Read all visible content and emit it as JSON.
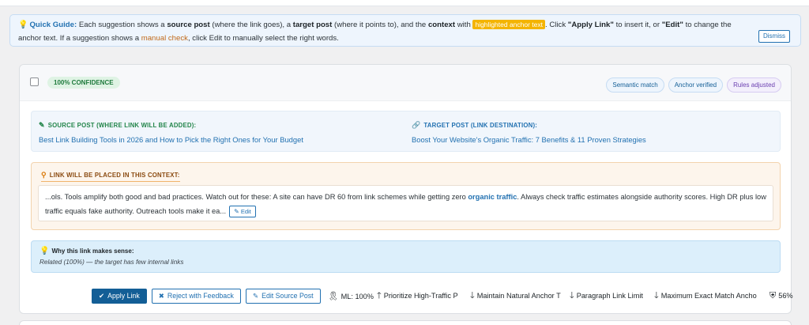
{
  "guide": {
    "lead": "Quick Guide:",
    "t1": " Each suggestion shows a ",
    "b1": "source post",
    "t2": " (where the link goes), a ",
    "b2": "target post",
    "t3": " (where it points to), and the ",
    "b3": "context",
    "t4": " with ",
    "chip": "highlighted anchor text",
    "t5": ". Click ",
    "b4": "\"Apply Link\"",
    "t6": " to insert it, or ",
    "b5": "\"Edit\"",
    "t7": " to change the anchor text. If a suggestion shows a ",
    "orange": "manual check",
    "t8": ", click Edit to manually select the right words.",
    "dismiss_label": "Dismiss"
  },
  "card": {
    "confidence": "100% CONFIDENCE",
    "chips": [
      "Semantic match",
      "Anchor verified",
      "Rules adjusted"
    ],
    "source": {
      "label": "SOURCE POST (WHERE LINK WILL BE ADDED):",
      "title": "Best Link Building Tools in 2026 and How to Pick the Right Ones for Your Budget"
    },
    "target": {
      "label": "TARGET POST (LINK DESTINATION):",
      "title": "Boost Your Website's Organic Traffic: 7 Benefits & 11 Proven Strategies"
    },
    "context": {
      "label": "LINK WILL BE PLACED IN THIS CONTEXT:",
      "before": "...ols. Tools amplify both good and bad practices. Watch out for these: A site can have DR 60 from link schemes while getting zero ",
      "anchor": "organic traffic",
      "after": ". Always check traffic estimates alongside authority scores. High DR plus low traffic equals fake authority. Outreach tools make it ea...",
      "edit_label": "Edit"
    },
    "why": {
      "title": "Why this link makes sense:",
      "text": "Related (100%) — the target has few internal links"
    },
    "actions": {
      "apply": "Apply Link",
      "reject": "Reject with Feedback",
      "edit_source": "Edit Source Post"
    },
    "meta": {
      "ml": "ML: 100%",
      "p1": "Prioritize High-Traffic P",
      "p2": "Maintain Natural Anchor T",
      "p3": "Paragraph Link Limit",
      "p4": "Maximum Exact Match Ancho",
      "score": "56%"
    }
  },
  "colors": {
    "accent": "#2271b1",
    "primary_button": "#135e96",
    "highlight_chip": "#f4b400",
    "confidence_green": "#1e7a3c",
    "context_orange": "#d97706"
  },
  "icons": [
    "lightbulb-icon",
    "pencil-icon",
    "link-icon",
    "map-pin-icon",
    "check-icon",
    "x-icon",
    "ribbon-icon",
    "arrow-up-icon",
    "arrow-down-icon",
    "shield-icon"
  ]
}
